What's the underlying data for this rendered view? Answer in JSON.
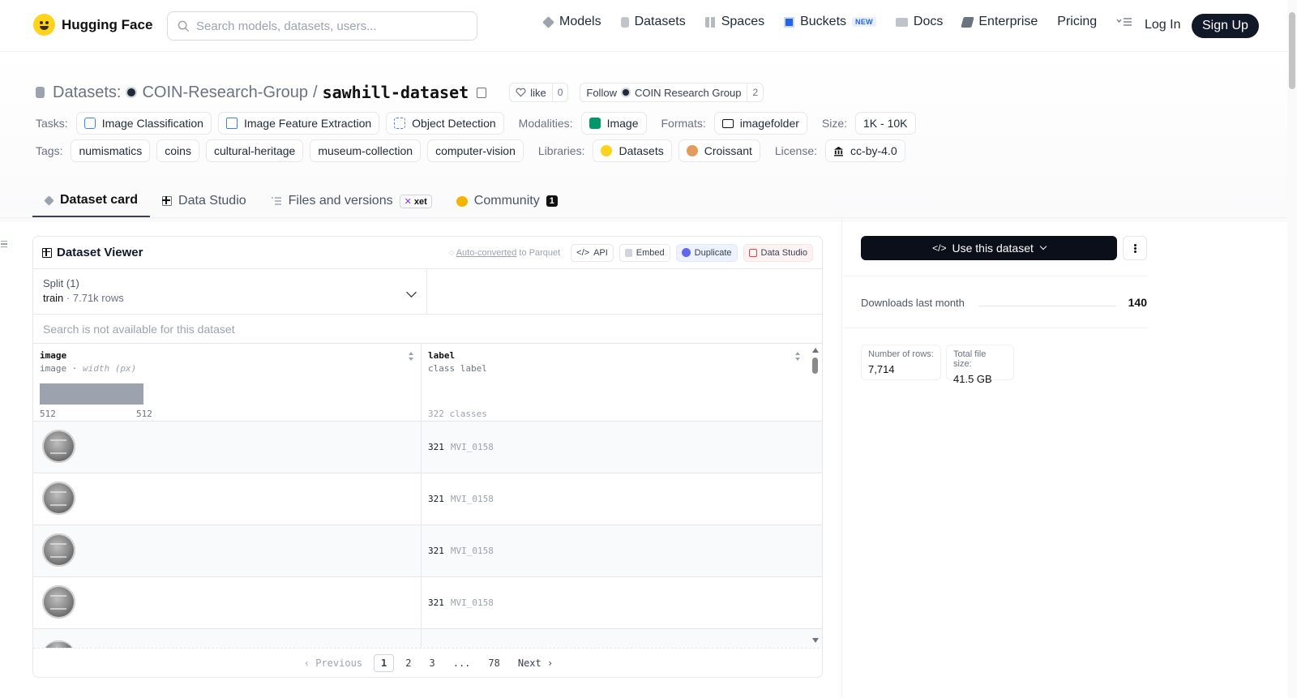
{
  "nav": {
    "brand": "Hugging Face",
    "search_placeholder": "Search models, datasets, users...",
    "links": [
      {
        "label": "Models",
        "icon": "cube-icon",
        "color": "#6b7280"
      },
      {
        "label": "Datasets",
        "icon": "database-icon",
        "color": "#9ca3af"
      },
      {
        "label": "Spaces",
        "icon": "grid-icon",
        "color": "#9ca3af"
      },
      {
        "label": "Buckets",
        "icon": "bucket-icon",
        "color": "#2563eb",
        "badge": "NEW"
      },
      {
        "label": "Docs",
        "icon": "book-icon",
        "color": "#9ca3af"
      },
      {
        "label": "Enterprise",
        "icon": "enterprise-icon",
        "color": "#6b7280"
      },
      {
        "label": "Pricing"
      }
    ],
    "login": "Log In",
    "signup": "Sign Up"
  },
  "repo": {
    "section": "Datasets:",
    "org": "COIN-Research-Group",
    "separator": "/",
    "name": "sawhill-dataset",
    "like_label": "like",
    "like_count": "0",
    "follow_label": "Follow",
    "follow_org": "COIN Research Group",
    "follow_count": "2"
  },
  "meta": {
    "tasks_label": "Tasks:",
    "tasks": [
      "Image Classification",
      "Image Feature Extraction",
      "Object Detection"
    ],
    "modalities_label": "Modalities:",
    "modalities": [
      "Image"
    ],
    "formats_label": "Formats:",
    "formats": [
      "imagefolder"
    ],
    "size_label": "Size:",
    "size": "1K - 10K",
    "tags_label": "Tags:",
    "tags": [
      "numismatics",
      "coins",
      "cultural-heritage",
      "museum-collection",
      "computer-vision"
    ],
    "libraries_label": "Libraries:",
    "libraries": [
      "Datasets",
      "Croissant"
    ],
    "license_label": "License:",
    "license": "cc-by-4.0"
  },
  "tabs": {
    "card": "Dataset card",
    "studio": "Data Studio",
    "files": "Files and versions",
    "xet": "xet",
    "community": "Community",
    "community_count": "1"
  },
  "viewer": {
    "title": "Dataset Viewer",
    "auto_link": "Auto-converted",
    "auto_rest": " to Parquet",
    "api": "API",
    "embed": "Embed",
    "duplicate": "Duplicate",
    "studio": "Data Studio",
    "split_label": "Split (1)",
    "split_name": "train",
    "split_rows": "7.71k rows",
    "search_na": "Search is not available for this dataset",
    "col1_name": "image",
    "col1_type": "image",
    "col1_sub": "width (px)",
    "col1_min": "512",
    "col1_max": "512",
    "col2_name": "label",
    "col2_type": "class label",
    "col2_classes": "322 classes",
    "rows": [
      {
        "label_id": "321",
        "label_name": "MVI_0158"
      },
      {
        "label_id": "321",
        "label_name": "MVI_0158"
      },
      {
        "label_id": "321",
        "label_name": "MVI_0158"
      },
      {
        "label_id": "321",
        "label_name": "MVI_0158"
      }
    ],
    "pager": {
      "previous": "‹ Previous",
      "pages": [
        "1",
        "2",
        "3",
        "...",
        "78"
      ],
      "next": "Next ›"
    }
  },
  "side": {
    "use_label": "Use this dataset",
    "downloads_label": "Downloads last month",
    "downloads": "140",
    "rows_label": "Number of rows:",
    "rows": "7,714",
    "size_label": "Total file size:",
    "size": "41.5 GB"
  }
}
